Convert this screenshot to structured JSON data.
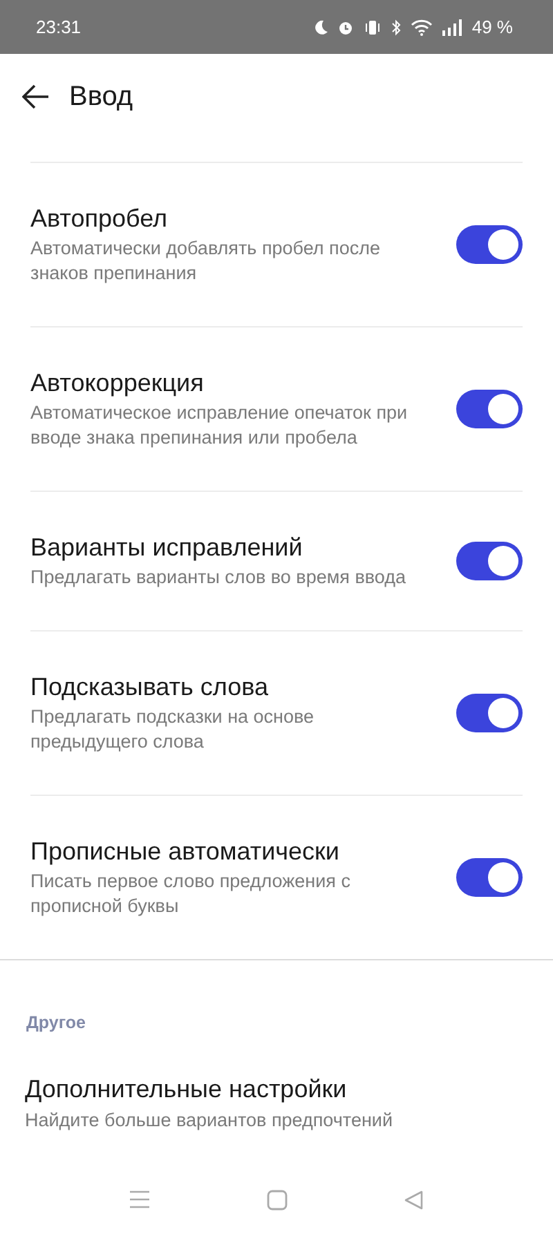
{
  "status_bar": {
    "time": "23:31",
    "battery": "49 %"
  },
  "header": {
    "title": "Ввод"
  },
  "settings": [
    {
      "title": "Автопробел",
      "subtitle": "Автоматически добавлять пробел после знаков препинания",
      "on": true
    },
    {
      "title": "Автокоррекция",
      "subtitle": "Автоматическое исправление опечаток при вводе знака препинания или пробела",
      "on": true
    },
    {
      "title": "Варианты исправлений",
      "subtitle": "Предлагать варианты слов во время ввода",
      "on": true
    },
    {
      "title": "Подсказывать слова",
      "subtitle": "Предлагать подсказки на основе предыдущего слова",
      "on": true
    },
    {
      "title": "Прописные автоматически",
      "subtitle": "Писать первое слово предложения с прописной буквы",
      "on": true
    }
  ],
  "other_section": {
    "heading": "Другое",
    "items": [
      {
        "title": "Дополнительные настройки",
        "subtitle": "Найдите больше вариантов предпочтений"
      }
    ]
  }
}
